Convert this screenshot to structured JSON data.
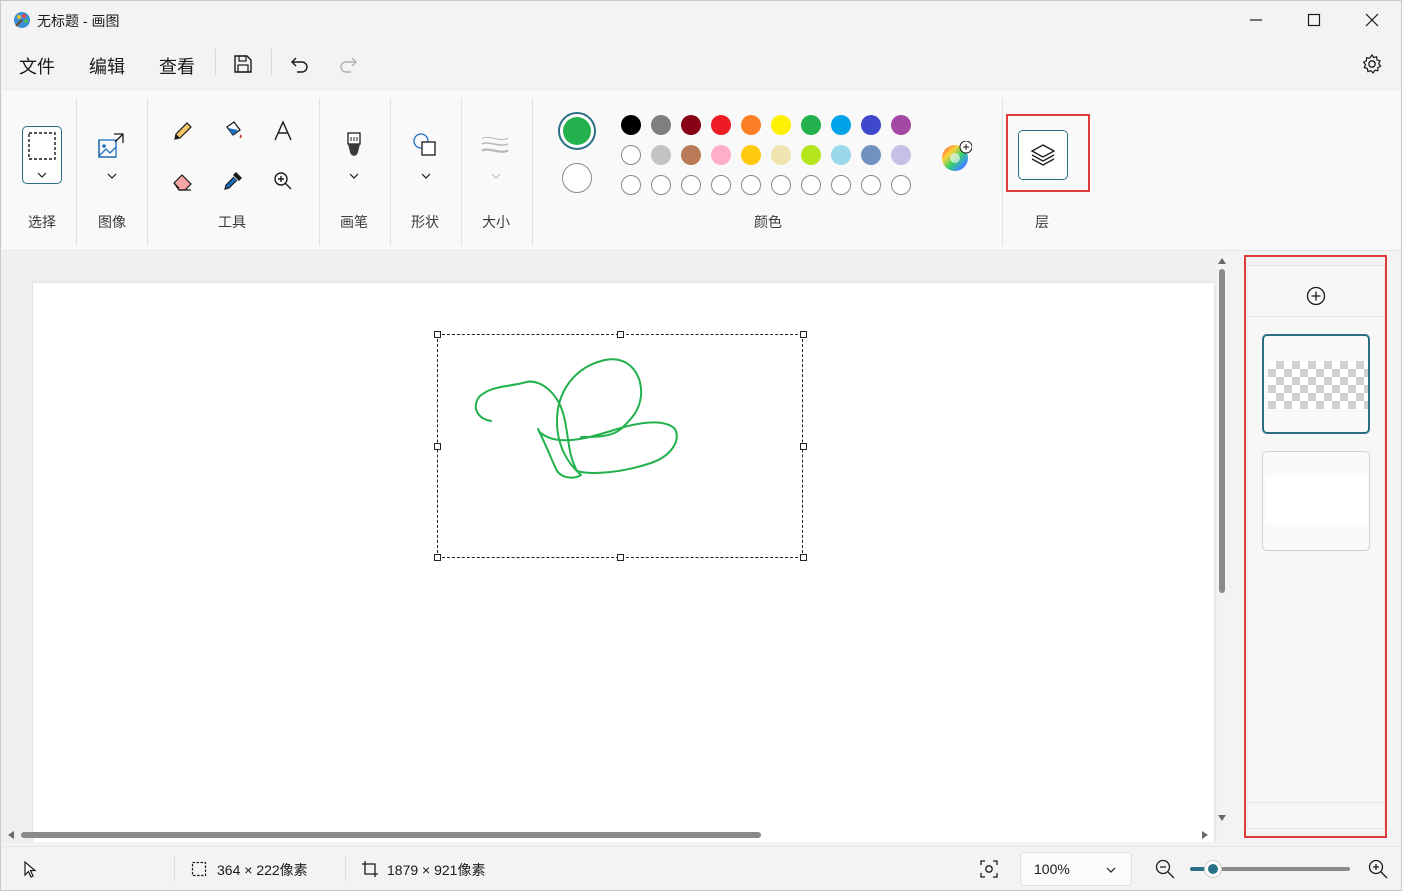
{
  "window": {
    "title": "无标题 - 画图"
  },
  "menu": {
    "file": "文件",
    "edit": "编辑",
    "view": "查看"
  },
  "ribbon": {
    "groups": {
      "select": "选择",
      "image": "图像",
      "tools": "工具",
      "brushes": "画笔",
      "shapes": "形状",
      "size": "大小",
      "colors": "颜色",
      "layers": "层"
    },
    "current_color_primary": "#22b14c",
    "current_color_secondary": "#ffffff",
    "palette_row1": [
      "#000000",
      "#7f7f7f",
      "#880015",
      "#ed1c24",
      "#ff7f27",
      "#fff200",
      "#22b14c",
      "#00a2e8",
      "#3f48cc",
      "#a349a4"
    ],
    "palette_row2": [
      "#ffffff",
      "#c3c3c3",
      "#b97a57",
      "#ffaec9",
      "#ffc90e",
      "#efe4b0",
      "#b5e61d",
      "#99d9ea",
      "#7092be",
      "#c8bfe7"
    ],
    "palette_row3": [
      "",
      "",
      "",
      "",
      "",
      "",
      "",
      "",
      "",
      ""
    ]
  },
  "status": {
    "selection_size": "364 × 222像素",
    "canvas_size": "1879 × 921像素",
    "zoom": "100%",
    "zoom_fraction": 0.08
  },
  "colors": {
    "accent": "#2a6f85",
    "highlight_box": "#e03a3a",
    "stroke": "#22b14c"
  }
}
